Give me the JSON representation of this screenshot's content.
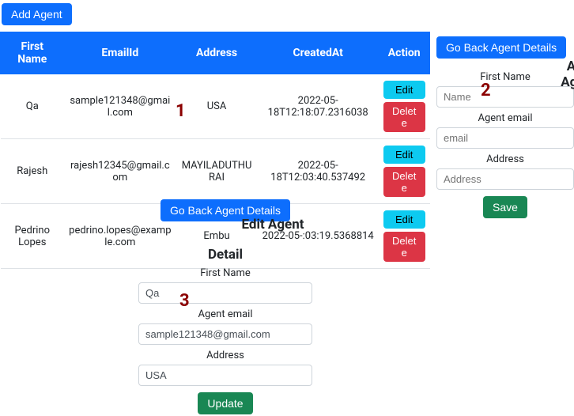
{
  "top": {
    "add_agent": "Add Agent"
  },
  "table": {
    "headers": {
      "first_name": "First Name",
      "email": "EmailId",
      "address": "Address",
      "created_at": "CreatedAt",
      "action": "Action"
    },
    "actions": {
      "edit": "Edit",
      "delete": "Delete"
    },
    "rows": [
      {
        "first_name": "Qa",
        "email": "sample121348@gmail.com",
        "address": "USA",
        "created_at": "2022-05-18T12:18:07.2316038"
      },
      {
        "first_name": "Rajesh",
        "email": "rajesh12345@gmail.com",
        "address": "MAYILADUTHURAI",
        "created_at": "2022-05-18T12:03:40.537492"
      },
      {
        "first_name": "Pedrino Lopes",
        "email": "pedrino.lopes@example.com",
        "address": "Embu",
        "created_at": "2022-05-:03:19.5368814"
      }
    ]
  },
  "edit_panel": {
    "go_back": "Go Back Agent Details",
    "title_a": "Detail",
    "title_b": "Edit Agent",
    "labels": {
      "first_name": "First Name",
      "email": "Agent email",
      "address": "Address"
    },
    "values": {
      "first_name": "Qa",
      "email": "sample121348@gmail.com",
      "address": "USA"
    },
    "update": "Update"
  },
  "add_panel": {
    "go_back": "Go Back Agent Details",
    "title": "Add Agent",
    "labels": {
      "first_name": "First Name",
      "email": "Agent email",
      "address": "Address"
    },
    "placeholders": {
      "first_name": "Name",
      "email": "email",
      "address": "Address"
    },
    "save": "Save"
  },
  "annotations": {
    "one": "1",
    "two": "2",
    "three": "3"
  }
}
